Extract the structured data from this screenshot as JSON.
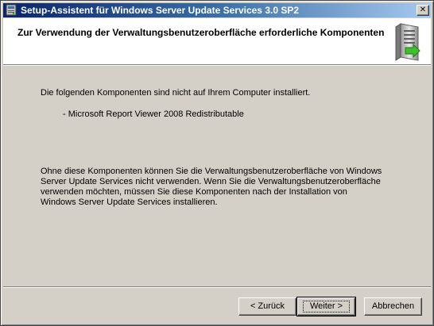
{
  "window": {
    "title": "Setup-Assistent für Windows Server Update Services 3.0 SP2",
    "close_label": "✕"
  },
  "header": {
    "title": "Zur Verwendung der Verwaltungsbenutzeroberfläche erforderliche Komponenten"
  },
  "content": {
    "intro": "Die folgenden Komponenten sind nicht auf Ihrem Computer installiert.",
    "components": [
      "- Microsoft Report Viewer 2008 Redistributable"
    ],
    "warning": "Ohne diese Komponenten können Sie die Verwaltungsbenutzeroberfläche von Windows Server Update Services nicht verwenden. Wenn Sie die Verwaltungsbenutzeroberfläche verwenden möchten, müssen Sie diese Komponenten nach der Installation von Windows Server Update Services installieren."
  },
  "buttons": {
    "back": "< Zurück",
    "next": "Weiter >",
    "cancel": "Abbrechen"
  },
  "icons": {
    "app": "setup-app-icon",
    "header": "server-update-icon"
  },
  "colors": {
    "titlebar_start": "#0a246a",
    "titlebar_end": "#a6caf0",
    "dialog_face": "#d4d0c8",
    "header_bg": "#ffffff"
  }
}
